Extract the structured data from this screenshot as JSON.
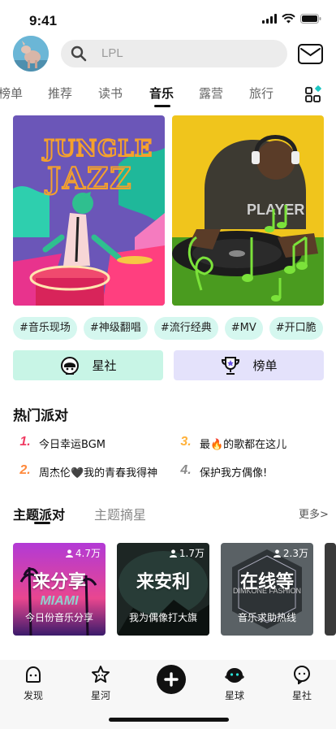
{
  "status_bar": {
    "time": "9:41"
  },
  "search": {
    "placeholder": "LPL"
  },
  "tabs": [
    {
      "label": "榜单",
      "active": false
    },
    {
      "label": "推荐",
      "active": false
    },
    {
      "label": "读书",
      "active": false
    },
    {
      "label": "音乐",
      "active": true
    },
    {
      "label": "露营",
      "active": false
    },
    {
      "label": "旅行",
      "active": false
    }
  ],
  "banners": {
    "left_text": [
      "JUNGLE",
      "JAZZ"
    ],
    "right_text": "PLAYER"
  },
  "hashtags": [
    "#音乐现场",
    "#神级翻唱",
    "#流行经典",
    "#MV",
    "#开口脆"
  ],
  "actions": {
    "star_community": "星社",
    "ranking": "榜单"
  },
  "hot_party": {
    "title": "热门派对",
    "items": [
      {
        "rank": "1.",
        "text": "今日幸运BGM"
      },
      {
        "rank": "3.",
        "text": "最🔥的歌都在这儿"
      },
      {
        "rank": "2.",
        "text": "周杰伦🖤我的青春我得神"
      },
      {
        "rank": "4.",
        "text": "保护我方偶像!"
      }
    ]
  },
  "theme_tabs": [
    {
      "label": "主题派对",
      "active": true
    },
    {
      "label": "主题摘星",
      "active": false
    }
  ],
  "more_label": "更多>",
  "theme_cards": [
    {
      "count": "4.7万",
      "title": "来分享",
      "subtitle": "今日份音乐分享",
      "bg_text": "MIAMI"
    },
    {
      "count": "1.7万",
      "title": "来安利",
      "subtitle": "我为偶像打大旗",
      "bg_text": ""
    },
    {
      "count": "2.3万",
      "title": "在线等",
      "subtitle": "音乐求助热线",
      "bg_text": "DIMKONE FASHION"
    }
  ],
  "bottom_nav": [
    {
      "label": "发现",
      "icon": "discover-icon"
    },
    {
      "label": "星河",
      "icon": "star-river-icon"
    },
    {
      "label": "星球",
      "icon": "planet-icon"
    },
    {
      "label": "星社",
      "icon": "star-community-icon"
    }
  ],
  "colors": {
    "tag_bg": "#d5f7ef",
    "star_button_bg": "#c8f5e6",
    "rank_button_bg": "#e4e2fb",
    "rank_1": "#f03c63",
    "rank_2": "#ff8a3d",
    "rank_3": "#ffb13a"
  }
}
